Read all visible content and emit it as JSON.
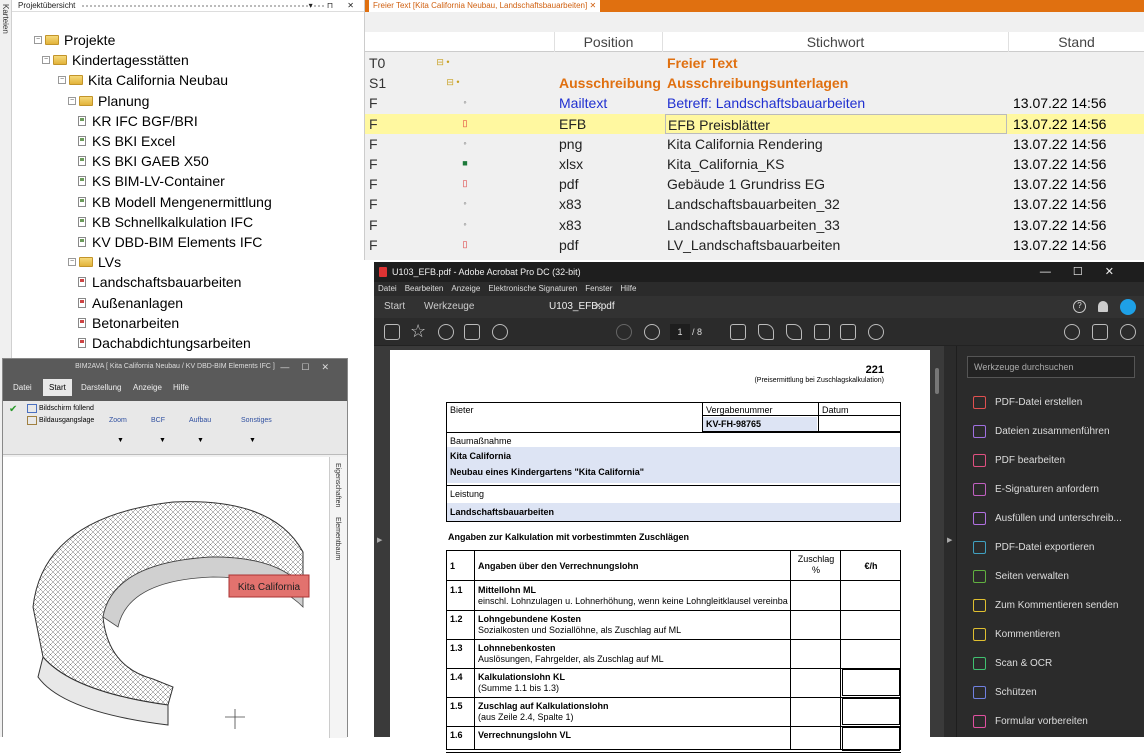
{
  "left_strip": {
    "label": "Karteien"
  },
  "project": {
    "title": "Projektübersicht",
    "tree": [
      {
        "label": "Projekte",
        "type": "folder",
        "level": 0
      },
      {
        "label": "Kindertagesstätten",
        "type": "folder",
        "level": 1
      },
      {
        "label": "Kita California Neubau",
        "type": "folder",
        "level": 2
      },
      {
        "label": "Planung",
        "type": "folder",
        "level": 3
      },
      {
        "label": "KR IFC BGF/BRI",
        "type": "doc-green",
        "level": 4
      },
      {
        "label": "KS BKI Excel",
        "type": "doc-green",
        "level": 4
      },
      {
        "label": "KS BKI GAEB X50",
        "type": "doc-green",
        "level": 4
      },
      {
        "label": "KS BIM-LV-Container",
        "type": "doc-green",
        "level": 4
      },
      {
        "label": "KB Modell Mengenermittlung",
        "type": "doc-green",
        "level": 4
      },
      {
        "label": "KB Schnellkalkulation IFC",
        "type": "doc-green",
        "level": 4
      },
      {
        "label": "KV DBD-BIM Elements IFC",
        "type": "doc-green",
        "level": 4
      },
      {
        "label": "LVs",
        "type": "folder",
        "level": 3
      },
      {
        "label": "Landschaftsbauarbeiten",
        "type": "doc-red",
        "level": 4
      },
      {
        "label": "Außenanlagen",
        "type": "doc-red",
        "level": 4
      },
      {
        "label": "Betonarbeiten",
        "type": "doc-red",
        "level": 4
      },
      {
        "label": "Dachabdichtungsarbeiten",
        "type": "doc-red",
        "level": 4
      }
    ]
  },
  "freetext": {
    "tab_label": "Freier Text [Kita California Neubau, Landschaftsbauarbeiten]",
    "columns": [
      "Position",
      "Stichwort",
      "Stand"
    ],
    "rows": [
      {
        "type": "T0",
        "position": "",
        "keyword": "Freier Text",
        "date": "",
        "style": "orange"
      },
      {
        "type": "S1",
        "position": "Ausschreibung",
        "keyword": "Ausschreibungsunterlagen",
        "date": "",
        "style": "orange"
      },
      {
        "type": "F",
        "position": "Mailtext",
        "keyword": "Betreff: Landschaftsbauarbeiten",
        "date": "13.07.22 14:56",
        "style": "blue"
      },
      {
        "type": "F",
        "position": "EFB",
        "keyword": "EFB Preisblätter",
        "date": "13.07.22 14:56",
        "style": "selected"
      },
      {
        "type": "F",
        "position": "png",
        "keyword": "Kita California Rendering",
        "date": "13.07.22 14:56",
        "style": "normal"
      },
      {
        "type": "F",
        "position": "xlsx",
        "keyword": "Kita_California_KS",
        "date": "13.07.22 14:56",
        "style": "normal"
      },
      {
        "type": "F",
        "position": "pdf",
        "keyword": "Gebäude 1 Grundriss EG",
        "date": "13.07.22 14:56",
        "style": "normal"
      },
      {
        "type": "F",
        "position": "x83",
        "keyword": "Landschaftsbauarbeiten_32",
        "date": "13.07.22 14:56",
        "style": "normal"
      },
      {
        "type": "F",
        "position": "x83",
        "keyword": "Landschaftsbauarbeiten_33",
        "date": "13.07.22 14:56",
        "style": "normal"
      },
      {
        "type": "F",
        "position": "pdf",
        "keyword": "LV_Landschaftsbauarbeiten",
        "date": "13.07.22 14:56",
        "style": "normal"
      }
    ]
  },
  "acrobat": {
    "title": "U103_EFB.pdf - Adobe Acrobat Pro DC (32-bit)",
    "menu": [
      "Datei",
      "Bearbeiten",
      "Anzeige",
      "Elektronische Signaturen",
      "Fenster",
      "Hilfe"
    ],
    "tabs": {
      "start": "Start",
      "tools": "Werkzeuge",
      "doc": "U103_EFB.pdf"
    },
    "page_current": "1",
    "page_total": "/ 8",
    "search_placeholder": "Werkzeuge durchsuchen",
    "tools": [
      {
        "label": "PDF-Datei erstellen",
        "color": "#e05050"
      },
      {
        "label": "Dateien zusammenführen",
        "color": "#a070e0"
      },
      {
        "label": "PDF bearbeiten",
        "color": "#e05080"
      },
      {
        "label": "E-Signaturen anfordern",
        "color": "#c060c0"
      },
      {
        "label": "Ausfüllen und unterschreib...",
        "color": "#b070e0"
      },
      {
        "label": "PDF-Datei exportieren",
        "color": "#40a0c0"
      },
      {
        "label": "Seiten verwalten",
        "color": "#60b040"
      },
      {
        "label": "Zum Kommentieren senden",
        "color": "#e0c030"
      },
      {
        "label": "Kommentieren",
        "color": "#e0c030"
      },
      {
        "label": "Scan & OCR",
        "color": "#40c070"
      },
      {
        "label": "Schützen",
        "color": "#7080e0"
      },
      {
        "label": "Formular vorbereiten",
        "color": "#e050a0"
      }
    ],
    "pdf": {
      "page_number": "221",
      "subtitle": "(Preisermittlung bei Zuschlagskalkulation)",
      "bieter": "Bieter",
      "vergabe_label": "Vergabenummer",
      "datum_label": "Datum",
      "vergabe_value": "KV-FH-98765",
      "baumassnahme_label": "Baumaßnahme",
      "baumassnahme_1": "Kita California",
      "baumassnahme_2": "Neubau eines Kindergartens \"Kita California\"",
      "leistung_label": "Leistung",
      "leistung_value": "Landschaftsbauarbeiten",
      "section_title": "Angaben zur Kalkulation mit vorbestimmten Zuschlägen",
      "table_head": {
        "num": "1",
        "label": "Angaben über den Verrechnungslohn",
        "zuschlag": "Zuschlag",
        "pct": "%",
        "unit": "€/h"
      },
      "rows": [
        {
          "num": "1.1",
          "bold": "Mittellohn ML",
          "text": "einschl. Lohnzulagen u. Lohnerhöhung, wenn keine Lohngleitklausel vereinbart wird"
        },
        {
          "num": "1.2",
          "bold": "Lohngebundene Kosten",
          "text": "Sozialkosten und Soziallöhne, als Zuschlag auf ML"
        },
        {
          "num": "1.3",
          "bold": "Lohnnebenkosten",
          "text": "Auslösungen, Fahrgelder, als Zuschlag auf ML"
        },
        {
          "num": "1.4",
          "bold": "Kalkulationslohn KL",
          "text": "(Summe 1.1 bis 1.3)"
        },
        {
          "num": "1.5",
          "bold": "Zuschlag auf Kalkulationslohn",
          "text": "(aus Zeile 2.4, Spalte 1)"
        },
        {
          "num": "1.6",
          "bold": "Verrechnungslohn VL",
          "text": ""
        }
      ]
    }
  },
  "bim": {
    "title": "BIM2AVA [ Kita California Neubau /  KV DBD-BIM Elements IFC ]",
    "tabs": [
      "Datei",
      "Start",
      "Darstellung",
      "Anzeige",
      "Hilfe"
    ],
    "ribbon_items": [
      "Bildschirm füllend",
      "Bildausgangslage"
    ],
    "ribbon_groups": [
      "Zoom",
      "BCF",
      "Aufbau",
      "Sonstiges"
    ],
    "side_tabs": [
      "Eigenschaften",
      "Elementbaum"
    ],
    "model_label": "Kita California"
  }
}
